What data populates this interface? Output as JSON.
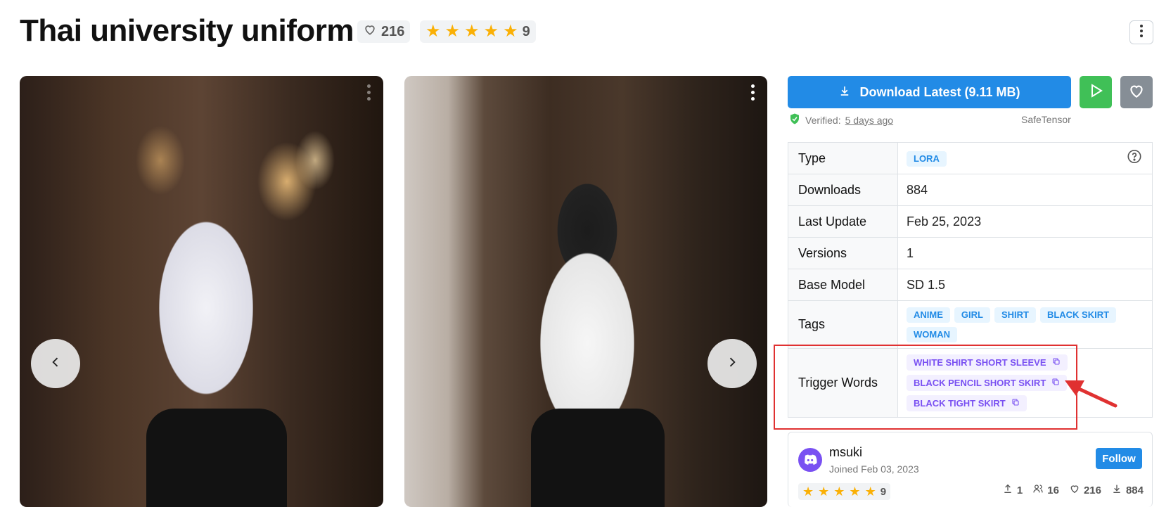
{
  "header": {
    "title": "Thai university uniform",
    "likes": "216",
    "rating_count": "9",
    "rating_stars": 5
  },
  "gallery": {
    "prev_icon": "chevron-left-icon",
    "next_icon": "chevron-right-icon"
  },
  "actions": {
    "download_label": "Download Latest (9.11 MB)",
    "verified_label": "Verified:",
    "verified_date": "5 days ago",
    "format": "SafeTensor"
  },
  "details": {
    "type_label": "Type",
    "type_value": "LORA",
    "downloads_label": "Downloads",
    "downloads_value": "884",
    "last_update_label": "Last Update",
    "last_update_value": "Feb 25, 2023",
    "versions_label": "Versions",
    "versions_value": "1",
    "base_model_label": "Base Model",
    "base_model_value": "SD 1.5",
    "tags_label": "Tags",
    "tags": [
      "ANIME",
      "GIRL",
      "SHIRT",
      "BLACK SKIRT",
      "WOMAN"
    ],
    "trigger_label": "Trigger Words",
    "trigger_words": [
      "WHITE SHIRT SHORT SLEEVE",
      "BLACK PENCIL SHORT SKIRT",
      "BLACK TIGHT SKIRT"
    ]
  },
  "creator": {
    "name": "msuki",
    "joined": "Joined Feb 03, 2023",
    "follow_label": "Follow",
    "rating_count": "9",
    "uploads": "1",
    "followers": "16",
    "favorites": "216",
    "downloads": "884"
  },
  "colors": {
    "primary": "#228be6",
    "success": "#40c057",
    "gray": "#868e96",
    "star": "#fab005",
    "tag_blue_bg": "#e7f5ff",
    "tag_purple_bg": "#f3f0ff",
    "highlight": "#e03131"
  }
}
